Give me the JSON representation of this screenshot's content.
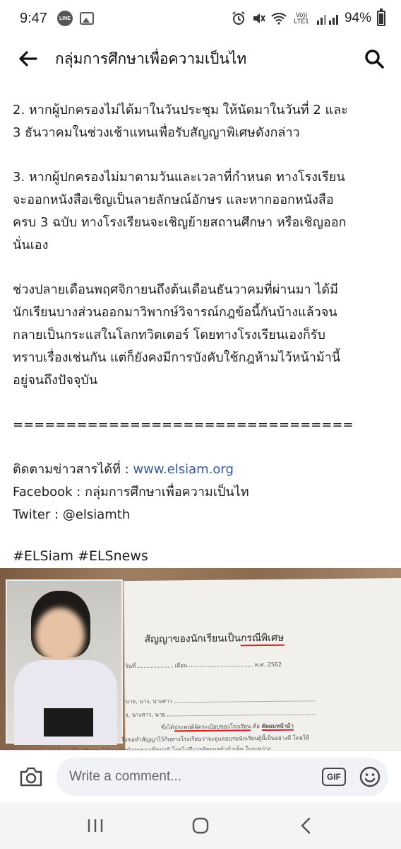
{
  "status_bar": {
    "time": "9:47",
    "line_badge": "LINE",
    "network": "Vo)) LTE1",
    "battery": "94%",
    "battery_level": 0.94,
    "icons": [
      "line-icon",
      "gallery-icon",
      "alarm-icon",
      "mute-icon",
      "wifi-icon",
      "signal-icon",
      "battery-icon"
    ]
  },
  "header": {
    "title": "กลุ่มการศึกษาเพื่อความเป็นไท",
    "back_icon": "arrow-left-icon",
    "search_icon": "search-icon"
  },
  "post": {
    "paragraphs": [
      [
        "2. หากผู้ปกครองไม่ได้มาในวันประชุม ให้นัดมาในวันที่ 2 และ",
        "3 ธันวาคมในช่วงเช้าแทนเพื่อรับสัญญาพิเศษดังกล่าว"
      ],
      [
        "3. หากผู้ปกครองไม่มาตามวันและเวลาที่กำหนด ทางโรงเรียน",
        "จะออกหนังสือเชิญเป็นลายลักษณ์อักษร และหากออกหนังสือ",
        "ครบ 3 ฉบับ ทางโรงเรียนจะเชิญย้ายสถานศึกษา หรือเชิญออก",
        "นั่นเอง"
      ],
      [
        "ช่วงปลายเดือนพฤศจิกายนถึงต้นเดือนธันวาคมที่ผ่านมา ได้มี",
        "นักเรียนบางส่วนออกมาวิพากษ์วิจารณ์กฎข้อนี้กันบ้างแล้วจน",
        "กลายเป็นกระแสในโลกทวิตเตอร์ โดยทางโรงเรียนเองก็รับ",
        "ทราบเรื่องเช่นกัน แต่ก็ยังคงมีการบังคับใช้กฎห้ามไว้หน้าม้านี้",
        "อยู่จนถึงปัจจุบัน"
      ]
    ],
    "separator": "================================",
    "follow_label": "ติดตามข่าวสารได้ที่ : ",
    "follow_link": "www.elsiam.org",
    "facebook_line": "Facebook : กลุ่มการศึกษาเพื่อความเป็นไท",
    "twitter_line": "Twiter : @elsiamth",
    "hashtags": "#ELSiam #ELSnews"
  },
  "photo": {
    "doc_title_prefix": "สัญญาของนักเรียนเป็น",
    "doc_title_highlight": "กรณีพิเศษ",
    "doc_date_label": "วันที่",
    "doc_month_label": "เดือน",
    "doc_year": "พ.ศ. 2562",
    "doc_line_1": "นาย, นาง, นางสาว",
    "doc_line_2": "ง, นางสาว, นาย",
    "doc_line_3_prefix": "ซึ่งได้",
    "doc_line_3_highlight": "ประพฤติผิดระเบียบของโรงเรียน",
    "doc_line_3_suffix": " คือ ",
    "doc_line_3_bold": "ตัดผมหน้าม้า",
    "doc_line_4": "จึงขอทำสัญญาไว้กับทางโรงเรียนว่าจะดูแลอบรมนักเรียนผู้นี้เป็นอย่างดี โดยให้",
    "doc_line_5": "นักเรียนแก้ไขปรับปรุง ไว้ผมหน้าม้าจนยาวเป็นปกติ โดยไม่มีการตัดผมหน้าม้าเพิ่ม ในระหว่าง"
  },
  "comment_bar": {
    "placeholder": "Write a comment...",
    "gif_label": "GIF",
    "camera_icon": "camera-icon",
    "emoji_icon": "emoji-icon"
  },
  "nav_bar": {
    "icons": [
      "recent-apps-icon",
      "home-icon",
      "back-icon"
    ]
  }
}
